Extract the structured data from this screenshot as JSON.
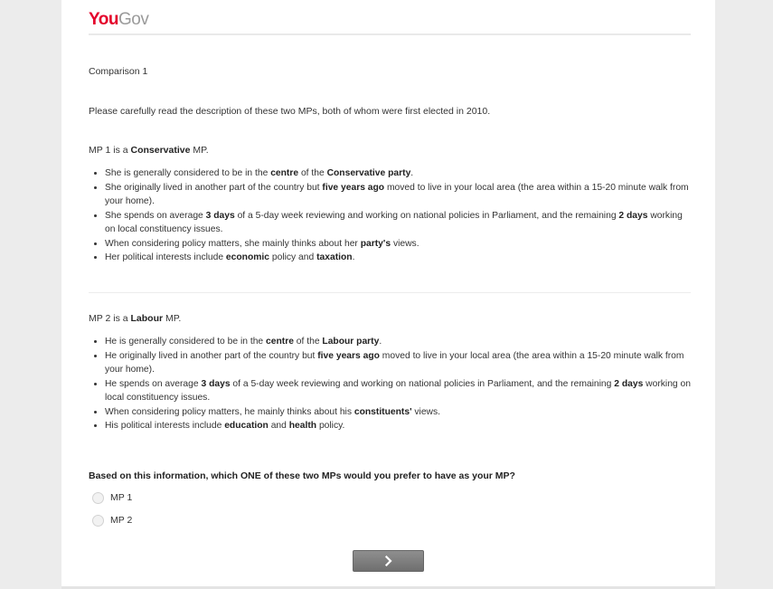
{
  "brand": {
    "part1": "You",
    "part2": "Gov"
  },
  "comparison_title": "Comparison 1",
  "intro": "Please carefully read the description of these two MPs, both of whom were first elected in 2010.",
  "mp1": {
    "heading": [
      {
        "t": "MP 1 is a ",
        "b": false
      },
      {
        "t": "Conservative",
        "b": true
      },
      {
        "t": " MP.",
        "b": false
      }
    ],
    "bullets": [
      [
        {
          "t": "She is generally considered to be in the ",
          "b": false
        },
        {
          "t": "centre",
          "b": true
        },
        {
          "t": " of the ",
          "b": false
        },
        {
          "t": "Conservative party",
          "b": true
        },
        {
          "t": ".",
          "b": false
        }
      ],
      [
        {
          "t": "She originally lived in another part of the country but ",
          "b": false
        },
        {
          "t": "five years ago",
          "b": true
        },
        {
          "t": " moved to live in your local area (the area within a 15-20 minute walk from your home).",
          "b": false
        }
      ],
      [
        {
          "t": "She spends on average ",
          "b": false
        },
        {
          "t": "3 days",
          "b": true
        },
        {
          "t": " of a 5-day week reviewing and working on national policies in Parliament, and the remaining ",
          "b": false
        },
        {
          "t": "2 days",
          "b": true
        },
        {
          "t": " working on local constituency issues.",
          "b": false
        }
      ],
      [
        {
          "t": "When considering policy matters, she mainly thinks about her ",
          "b": false
        },
        {
          "t": "party's",
          "b": true
        },
        {
          "t": " views.",
          "b": false
        }
      ],
      [
        {
          "t": "Her political interests include ",
          "b": false
        },
        {
          "t": "economic",
          "b": true
        },
        {
          "t": " policy and ",
          "b": false
        },
        {
          "t": "taxation",
          "b": true
        },
        {
          "t": ".",
          "b": false
        }
      ]
    ]
  },
  "mp2": {
    "heading": [
      {
        "t": "MP 2 is a ",
        "b": false
      },
      {
        "t": "Labour",
        "b": true
      },
      {
        "t": " MP.",
        "b": false
      }
    ],
    "bullets": [
      [
        {
          "t": "He is generally considered to be in the ",
          "b": false
        },
        {
          "t": "centre",
          "b": true
        },
        {
          "t": " of the ",
          "b": false
        },
        {
          "t": "Labour party",
          "b": true
        },
        {
          "t": ".",
          "b": false
        }
      ],
      [
        {
          "t": "He originally lived in another part of the country but ",
          "b": false
        },
        {
          "t": "five years ago",
          "b": true
        },
        {
          "t": " moved to live in your local area (the area within a 15-20 minute walk from your home).",
          "b": false
        }
      ],
      [
        {
          "t": "He spends on average ",
          "b": false
        },
        {
          "t": "3 days",
          "b": true
        },
        {
          "t": " of a 5-day week reviewing and working on national policies in Parliament, and the remaining ",
          "b": false
        },
        {
          "t": "2 days",
          "b": true
        },
        {
          "t": " working on local constituency issues.",
          "b": false
        }
      ],
      [
        {
          "t": "When considering policy matters, he mainly thinks about his ",
          "b": false
        },
        {
          "t": "constituents'",
          "b": true
        },
        {
          "t": " views.",
          "b": false
        }
      ],
      [
        {
          "t": "His political interests include ",
          "b": false
        },
        {
          "t": "education",
          "b": true
        },
        {
          "t": " and ",
          "b": false
        },
        {
          "t": "health",
          "b": true
        },
        {
          "t": " policy.",
          "b": false
        }
      ]
    ]
  },
  "question": "Based on this information, which ONE of these two MPs would you prefer to have as your MP?",
  "options": [
    "MP 1",
    "MP 2"
  ],
  "next_icon": "chevron-right-icon",
  "colors": {
    "brand_red": "#e4002b",
    "brand_grey": "#9a9a9a",
    "button": "#7a7a7a"
  }
}
